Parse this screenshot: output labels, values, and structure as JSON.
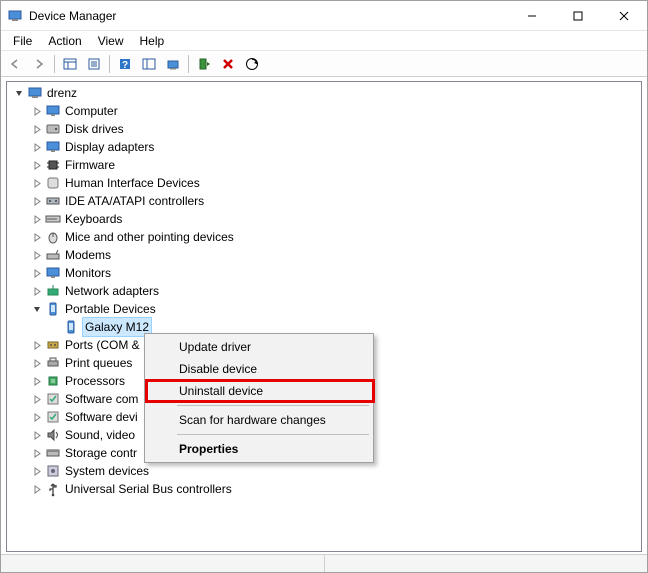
{
  "window": {
    "title": "Device Manager"
  },
  "menubar": {
    "items": [
      "File",
      "Action",
      "View",
      "Help"
    ]
  },
  "toolbar": {
    "buttons": [
      "back",
      "forward",
      "show-hidden",
      "properties",
      "help",
      "update-driver",
      "scan-hardware",
      "uninstall-device",
      "disable-device",
      "add-legacy"
    ]
  },
  "tree": {
    "root": {
      "label": "drenz",
      "expanded": true
    },
    "categories": [
      {
        "label": "Computer",
        "icon": "monitor-icon"
      },
      {
        "label": "Disk drives",
        "icon": "disk-icon"
      },
      {
        "label": "Display adapters",
        "icon": "monitor-icon"
      },
      {
        "label": "Firmware",
        "icon": "chip-icon"
      },
      {
        "label": "Human Interface Devices",
        "icon": "hid-icon"
      },
      {
        "label": "IDE ATA/ATAPI controllers",
        "icon": "controller-icon"
      },
      {
        "label": "Keyboards",
        "icon": "keyboard-icon"
      },
      {
        "label": "Mice and other pointing devices",
        "icon": "mouse-icon"
      },
      {
        "label": "Modems",
        "icon": "modem-icon"
      },
      {
        "label": "Monitors",
        "icon": "monitor-icon"
      },
      {
        "label": "Network adapters",
        "icon": "network-icon"
      },
      {
        "label": "Portable Devices",
        "icon": "portable-icon",
        "expanded": true,
        "children": [
          {
            "label": "Galaxy M12",
            "icon": "portable-device-icon",
            "selected": true
          }
        ]
      },
      {
        "label": "Ports (COM &",
        "icon": "port-icon"
      },
      {
        "label": "Print queues",
        "icon": "printer-icon"
      },
      {
        "label": "Processors",
        "icon": "cpu-icon"
      },
      {
        "label": "Software com",
        "icon": "software-icon"
      },
      {
        "label": "Software devi",
        "icon": "software-icon"
      },
      {
        "label": "Sound, video",
        "icon": "sound-icon"
      },
      {
        "label": "Storage contr",
        "icon": "storage-icon"
      },
      {
        "label": "System devices",
        "icon": "system-icon"
      },
      {
        "label": "Universal Serial Bus controllers",
        "icon": "usb-icon"
      }
    ]
  },
  "context_menu": {
    "items": [
      {
        "label": "Update driver"
      },
      {
        "label": "Disable device"
      },
      {
        "label": "Uninstall device",
        "highlighted": true
      },
      {
        "sep": true
      },
      {
        "label": "Scan for hardware changes"
      },
      {
        "sep": true
      },
      {
        "label": "Properties",
        "bold": true
      }
    ]
  }
}
